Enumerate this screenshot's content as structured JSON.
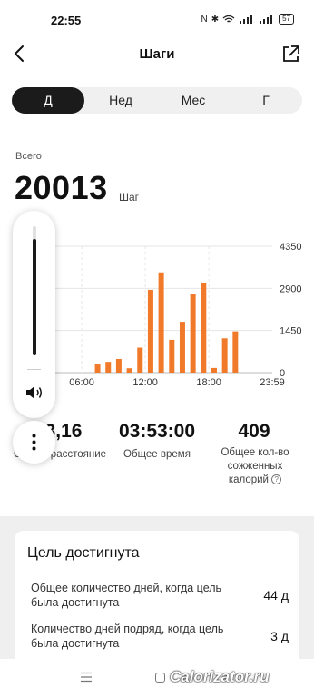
{
  "status_bar": {
    "time": "22:55",
    "battery": "57",
    "icons": [
      "nfc-icon",
      "bluetooth-icon",
      "wifi-icon",
      "signal-icon",
      "signal-icon",
      "battery-icon"
    ]
  },
  "header": {
    "title": "Шаги"
  },
  "tabs": [
    {
      "label": "Д",
      "active": true
    },
    {
      "label": "Нед",
      "active": false
    },
    {
      "label": "Мес",
      "active": false
    },
    {
      "label": "Г",
      "active": false
    }
  ],
  "summary": {
    "label": "Всего",
    "value": "20013",
    "unit": "Шаг"
  },
  "chart_data": {
    "type": "bar",
    "x_tick_labels": [
      "06:00",
      "12:00",
      "18:00",
      "23:59"
    ],
    "y_tick_labels": [
      "4350",
      "2900",
      "1450",
      "0"
    ],
    "ylim": [
      0,
      4350
    ],
    "values": [
      0,
      0,
      0,
      0,
      0,
      0,
      0,
      0,
      0,
      0,
      0,
      0,
      0,
      0,
      0,
      0,
      0,
      0,
      0,
      0,
      0,
      0,
      0,
      0,
      0,
      0,
      0,
      0,
      0,
      0,
      0,
      0,
      0,
      0,
      0,
      0,
      0,
      0,
      0,
      0,
      0,
      0,
      0,
      0,
      0,
      0,
      0,
      0,
      0,
      0,
      0,
      0,
      0,
      0,
      0,
      0,
      0,
      0,
      0,
      0,
      0,
      0,
      0,
      0,
      0,
      0,
      0,
      0,
      0,
      0,
      0,
      0,
      0,
      0,
      0,
      0,
      0,
      0,
      0,
      0,
      0,
      0,
      0,
      0,
      0,
      0,
      0,
      0,
      0,
      0,
      0,
      0,
      0,
      0,
      0,
      0
    ],
    "bars": [
      {
        "time": "07:30",
        "value": 280
      },
      {
        "time": "08:30",
        "value": 370
      },
      {
        "time": "09:30",
        "value": 470
      },
      {
        "time": "10:30",
        "value": 150
      },
      {
        "time": "11:30",
        "value": 860
      },
      {
        "time": "12:30",
        "value": 2850
      },
      {
        "time": "13:30",
        "value": 3450
      },
      {
        "time": "14:30",
        "value": 1130
      },
      {
        "time": "15:30",
        "value": 1750
      },
      {
        "time": "16:30",
        "value": 2720
      },
      {
        "time": "17:30",
        "value": 3100
      },
      {
        "time": "18:30",
        "value": 160
      },
      {
        "time": "19:30",
        "value": 1180
      },
      {
        "time": "20:30",
        "value": 1420
      }
    ],
    "color": "#f07a2a",
    "grid": true
  },
  "stats": [
    {
      "value": "3,16",
      "label": "Общее расстояние"
    },
    {
      "value": "03:53:00",
      "label": "Общее время"
    },
    {
      "value": "409",
      "label": "Общее кол-во сожженных калорий"
    }
  ],
  "goal": {
    "title": "Цель достигнута",
    "rows": [
      {
        "label": "Общее количество дней, когда цель была достигнута",
        "value": "44 д"
      },
      {
        "label": "Количество дней подряд, когда цель была достигнута",
        "value": "3 д"
      }
    ]
  },
  "volume": {
    "level": 0.9
  },
  "watermark": "Calorizator.ru",
  "colors": {
    "accent": "#f07a2a",
    "active_tab": "#1b1b1b",
    "goal_bg": "#efefef"
  }
}
